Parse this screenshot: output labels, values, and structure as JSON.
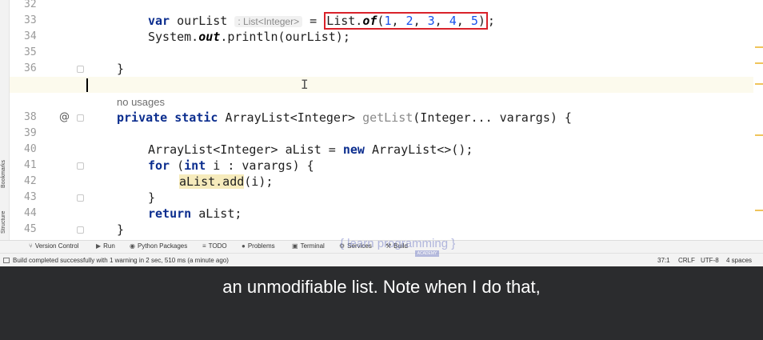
{
  "sidebar": {
    "bookmarks": "Bookmarks",
    "structure": "Structure"
  },
  "gutter": {
    "line_numbers": [
      "32",
      "33",
      "34",
      "35",
      "36",
      "37",
      "38",
      "39",
      "40",
      "41",
      "42",
      "43",
      "44",
      "45"
    ],
    "override_icon": "@"
  },
  "code": {
    "l33": {
      "kw": "var",
      "name": " ourList ",
      "hint": ": List<Integer>",
      "eq": " = ",
      "boxed_a": "List.",
      "boxed_fn": "of",
      "boxed_b": "(",
      "n1": "1",
      "c1": ", ",
      "n2": "2",
      "c2": ", ",
      "n3": "3",
      "c3": ", ",
      "n4": "4",
      "c4": ", ",
      "n5": "5",
      "boxed_c": ")",
      "semi": ";"
    },
    "l34": {
      "a": "System.",
      "out": "out",
      "b": ".println(ourList);"
    },
    "l36": "}",
    "no_usages": "no usages",
    "l38": {
      "kw": "private static",
      "a": " ArrayList<Integer> ",
      "fn": "getList",
      "b": "(Integer... varargs) {"
    },
    "l40": {
      "a": "ArrayList<Integer> aList = ",
      "kw": "new",
      "b": " ArrayList<>();"
    },
    "l41": {
      "kw1": "for",
      "a": " (",
      "kw2": "int",
      "b": " i : varargs) {"
    },
    "l42": {
      "warn": "aList.add",
      "b": "(i);"
    },
    "l43": "}",
    "l44": {
      "kw": "return",
      "a": " aList;"
    },
    "l45": "}"
  },
  "toolbar": {
    "version_control": "Version Control",
    "run": "Run",
    "python_packages": "Python Packages",
    "todo": "TODO",
    "problems": "Problems",
    "terminal": "Terminal",
    "services": "Services",
    "build": "Build"
  },
  "status": {
    "message": "Build completed successfully with 1 warning in 2 sec, 510 ms (a minute ago)",
    "position": "37:1",
    "line_ending": "CRLF",
    "encoding": "UTF-8",
    "indent": "4 spaces"
  },
  "watermark": {
    "text": "{ learn programming }",
    "sub": "ACADEMY"
  },
  "caption": "an unmodifiable list. Note when I do that,",
  "colors": {
    "keyword": "#0b2d8e",
    "number": "#1750eb",
    "highlight_box": "#d9222a",
    "warning_bg": "#f6ebbc",
    "caption_bg": "#2b2c2e"
  }
}
